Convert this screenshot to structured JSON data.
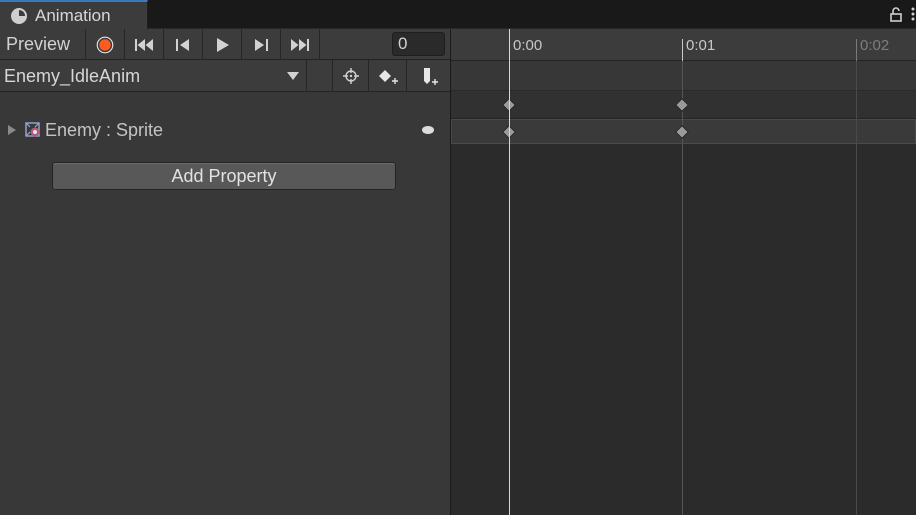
{
  "tab": {
    "title": "Animation"
  },
  "toolbar": {
    "preview_label": "Preview",
    "frame_value": "0",
    "buttons": [
      "record",
      "first-key",
      "prev-key",
      "play",
      "next-key",
      "last-key"
    ]
  },
  "clip": {
    "name": "Enemy_IdleAnim"
  },
  "properties": [
    {
      "label": "Enemy : Sprite"
    }
  ],
  "add_property_label": "Add Property",
  "timeline": {
    "ticks": [
      "0:00",
      "0:01",
      "0:02"
    ],
    "keyframe_times": [
      "0:00",
      "0:01"
    ]
  },
  "colors": {
    "record_red": "#ff5a1f",
    "accent_blue": "#3a79bb"
  }
}
